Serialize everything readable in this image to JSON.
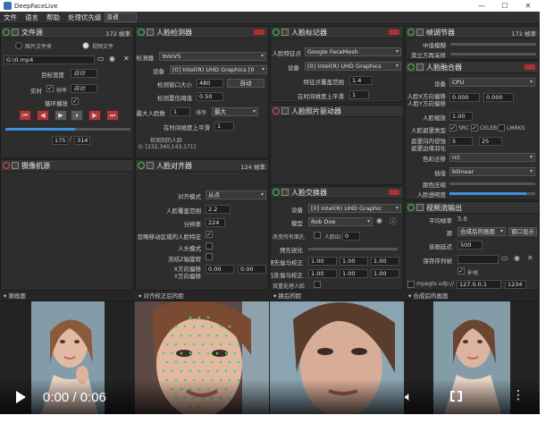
{
  "app": {
    "title": "DeepFaceLive"
  },
  "window": {
    "min": "—",
    "max": "☐",
    "close": "✕"
  },
  "menu": {
    "file": "文件",
    "language": "语言",
    "help": "帮助",
    "priority_label": "处理优先级",
    "priority_value": "普通"
  },
  "file_source": {
    "title": "文件源",
    "fps": "172 帧率",
    "opt_image_folder": "图片文件夹",
    "opt_video_file": "视频文件",
    "path": "G:\\0.mp4",
    "target_width_label": "目标宽度",
    "target_width_value": "自动",
    "realtime_label": "实时",
    "fps_label": "帧率",
    "fps_value": "自动",
    "loop_label": "循环播放",
    "frame_current": "175",
    "frame_total": "314"
  },
  "camera_source": {
    "title": "摄像机源"
  },
  "face_detector": {
    "title": "人脸检测器",
    "detector_label": "检测器",
    "detector_value": "YoloV5",
    "device_label": "设备",
    "device_value": "[0] Intel(R) UHD Graphics [0",
    "window_size_label": "检测窗口大小",
    "window_size_value": "480",
    "window_size_auto": "自动",
    "threshold_label": "检测置信阈值",
    "threshold_value": "0.50",
    "max_faces_label": "最大人脸数",
    "max_faces_value": "1",
    "sort_label": "排序",
    "sort_value": "最大",
    "temporal_label": "在时间维度上平滑",
    "temporal_value": "1",
    "detected_label": "检测到的人脸",
    "detected_info": "0: [232,340,143,171]"
  },
  "face_aligner": {
    "title": "人脸对齐器",
    "fps": "124 帧率",
    "align_mode_label": "对齐模式",
    "align_mode_value": "从点",
    "coverage_label": "人脸覆盖范围",
    "coverage_value": "2.2",
    "resolution_label": "分辨率",
    "resolution_value": "224",
    "exclude_moving_label": "忽略移动区域的人脸特征",
    "head_mode_label": "人头模式",
    "freeze_z_label": "冻结Z轴旋转",
    "x_offset_label": "X方向偏移",
    "y_offset_label": "Y方向偏移",
    "x_offset_value": "0.00",
    "y_offset_value": "0.00"
  },
  "face_marker": {
    "title": "人脸标记器",
    "marker_label": "人脸特征点",
    "marker_value": "Google FaceMesh",
    "device_label": "设备",
    "device_value": "[0] Intel(R) UHD Graphics",
    "coverage_label": "特征点覆盖范围",
    "coverage_value": "1.4",
    "temporal_label": "在时间维度上平滑",
    "temporal_value": "1"
  },
  "face_animator": {
    "title": "人脸照片驱动器"
  },
  "face_swapper": {
    "title": "人脸交换器",
    "device_label": "设备",
    "device_value": "[0] Intel(R) UHD Graphic",
    "model_label": "模型",
    "model_value": "Rob Doe",
    "swap_all_label": "改变所有面孔",
    "face_id_label": "人脸ID",
    "face_id_value": "0",
    "pre_sharpen_label": "预先锐化",
    "pre_gamma_label": "预先伽马校正",
    "post_gamma_label": "后处伽马校正",
    "gamma_r": "1.00",
    "gamma_g": "1.00",
    "gamma_b": "1.00",
    "two_pass_label": "双重处理人脸"
  },
  "frame_adjuster": {
    "title": "帧调节器",
    "fps": "172 帧率",
    "median_label": "中值模糊",
    "degrade_label": "双立方再采样"
  },
  "face_merger": {
    "title": "人脸融合器",
    "device_label": "设备",
    "device_value": "CPU",
    "x_offset_label": "人脸X方向偏移",
    "y_offset_label": "人脸Y方向偏移",
    "x_offset_value": "0.000",
    "y_offset_value": "0.000",
    "scale_label": "人脸缩放",
    "scale_value": "1.00",
    "mask_type_label": "人脸遮罩类型",
    "mask_src": "SRC",
    "mask_celeb": "CELEB",
    "mask_lmrks": "LMRKS",
    "erode_label": "遮罩向内侵蚀",
    "blur_label": "遮罩边缘羽化",
    "erode_value": "5",
    "blur_value": "25",
    "color_transfer_label": "色彩迁移",
    "color_transfer_value": "rct",
    "interpolation_label": "插值",
    "interpolation_value": "bilinear",
    "color_compression_label": "颜色压缩",
    "opacity_label": "人脸透明度",
    "opacity": 0.9
  },
  "stream_output": {
    "title": "视频流输出",
    "avg_fps_label": "平均帧率",
    "avg_fps_value": "5.6",
    "source_label": "源",
    "source_value": "合成后的画面",
    "window_btn": "窗口显示",
    "delay_label": "音画延迟",
    "delay_value": "500",
    "save_path_label": "保存序列帧",
    "fill_frame_label": "补帧",
    "mpegts_label": "mpegts udp://",
    "mpegts_host": "127.0.0.1",
    "mpegts_port": "1234"
  },
  "views": {
    "source": "源画面",
    "aligned": "对齐校正后的脸",
    "swapped": "换后的脸",
    "merged": "合成后的画面"
  },
  "video": {
    "time": "0:00 / 0:06"
  }
}
